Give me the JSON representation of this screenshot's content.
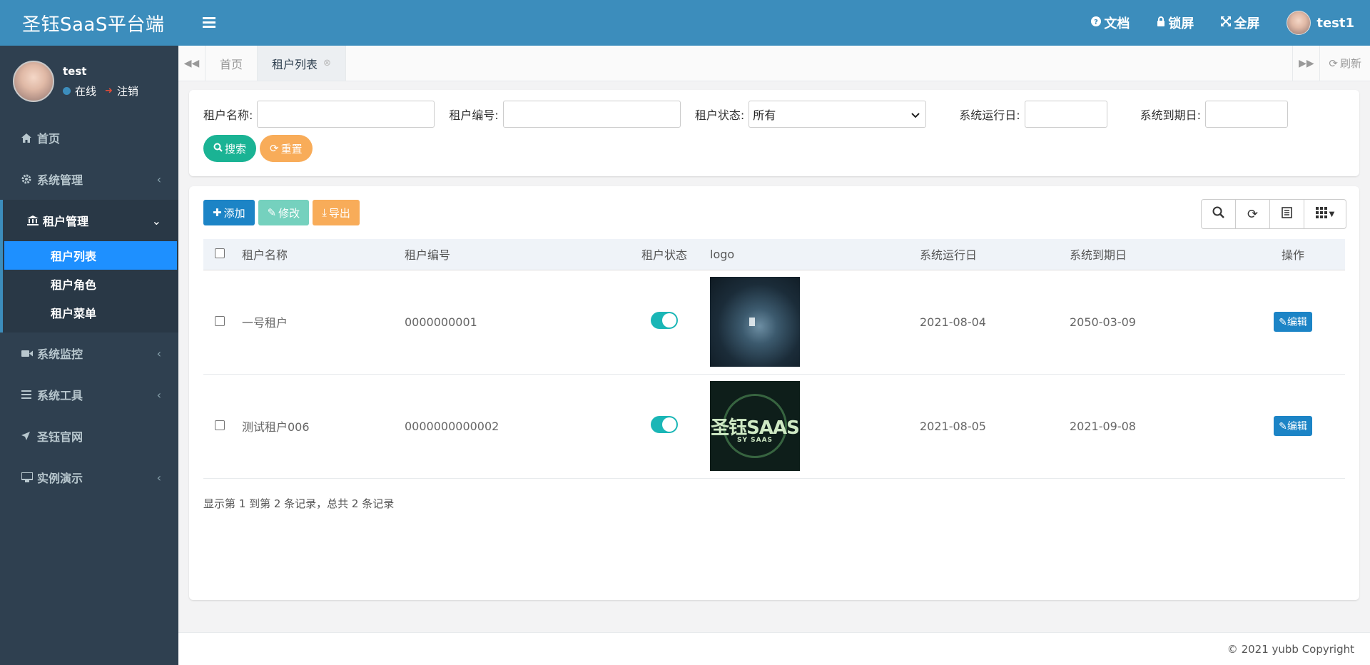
{
  "brand": {
    "title": "圣钰SaaS平台端"
  },
  "user": {
    "name": "test",
    "status": "在线",
    "logout": "注销"
  },
  "sidebar": {
    "items": [
      {
        "label": "首页"
      },
      {
        "label": "系统管理"
      },
      {
        "label": "租户管理",
        "sub": [
          "租户列表",
          "租户角色",
          "租户菜单"
        ]
      },
      {
        "label": "系统监控"
      },
      {
        "label": "系统工具"
      },
      {
        "label": "圣钰官网"
      },
      {
        "label": "实例演示"
      }
    ]
  },
  "header": {
    "docs": "文档",
    "lock": "锁屏",
    "fullscreen": "全屏",
    "username": "test1"
  },
  "tabs": {
    "items": [
      "首页",
      "租户列表"
    ],
    "refresh": "刷新"
  },
  "search": {
    "tenant_name_label": "租户名称:",
    "tenant_code_label": "租户编号:",
    "tenant_status_label": "租户状态:",
    "tenant_status_value": "所有",
    "run_date_label": "系统运行日:",
    "expire_date_label": "系统到期日:",
    "search_button": "搜索",
    "reset_button": "重置"
  },
  "toolbar": {
    "add": "添加",
    "edit": "修改",
    "export": "导出"
  },
  "table": {
    "headers": [
      "租户名称",
      "租户编号",
      "租户状态",
      "logo",
      "系统运行日",
      "系统到期日",
      "操作"
    ],
    "rows": [
      {
        "name": "一号租户",
        "code": "0000000001",
        "run": "2021-08-04",
        "expire": "2050-03-09",
        "action": "编辑"
      },
      {
        "name": "测试租户006",
        "code": "0000000000002",
        "run": "2021-08-05",
        "expire": "2021-09-08",
        "action": "编辑"
      }
    ],
    "logo2_text": "圣钰SAAS",
    "logo2_sub": "SY SAAS",
    "pager": "显示第 1 到第 2 条记录，总共 2 条记录"
  },
  "footer": {
    "copyright": "© 2021 yubb Copyright"
  },
  "colors": {
    "primary": "#3c8dbc",
    "sidebar": "#2f4050",
    "green": "#1ab394",
    "orange": "#f8ac59",
    "blue": "#1c84c6",
    "active_sub": "#1e90ff"
  }
}
